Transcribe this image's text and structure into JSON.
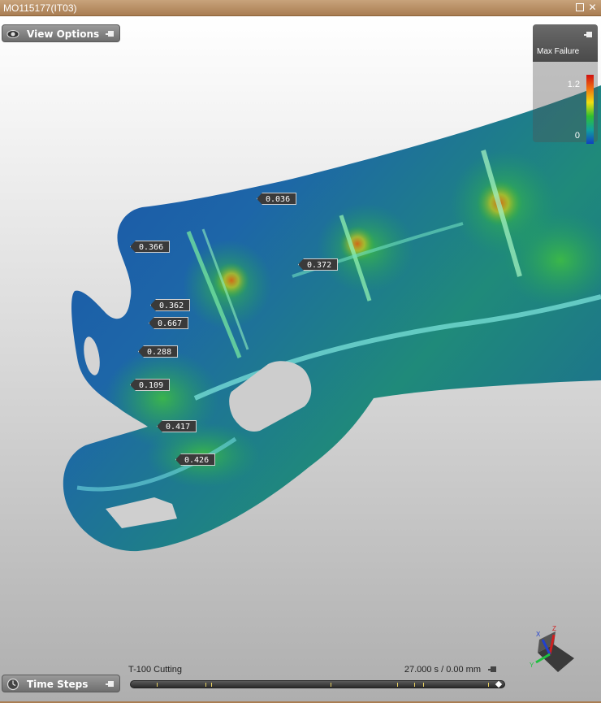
{
  "window": {
    "title": "MO115177(IT03)"
  },
  "view_options": {
    "label": "View Options"
  },
  "time_steps": {
    "label": "Time Steps"
  },
  "legend": {
    "title": "Max Failure",
    "max": "1.2",
    "min": "0",
    "colors": [
      "#d01010",
      "#f07010",
      "#f0e010",
      "#30c030",
      "#10a0a0",
      "#1040c0"
    ]
  },
  "callouts": [
    {
      "value": "0.036"
    },
    {
      "value": "0.366"
    },
    {
      "value": "0.372"
    },
    {
      "value": "0.362"
    },
    {
      "value": "0.667"
    },
    {
      "value": "0.288"
    },
    {
      "value": "0.109"
    },
    {
      "value": "0.417"
    },
    {
      "value": "0.426"
    }
  ],
  "timeline": {
    "step_name": "T-100 Cutting",
    "time_readout": "27.000 s / 0.00 mm"
  },
  "triad": {
    "x_label": "X",
    "y_label": "Y",
    "z_label": "Z"
  }
}
